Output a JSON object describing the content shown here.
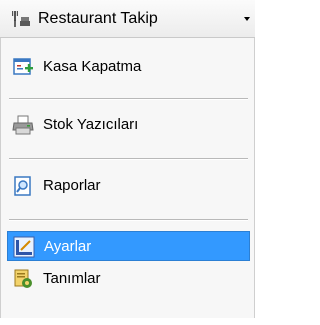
{
  "header": {
    "title": "Restaurant Takip",
    "icon": "restaurant-tools-icon"
  },
  "menu": {
    "items": [
      {
        "label": "Kasa Kapatma",
        "icon": "cash-register-icon"
      },
      {
        "label": "Stok Yazıcıları",
        "icon": "printer-icon"
      },
      {
        "label": "Raporlar",
        "icon": "report-search-icon"
      },
      {
        "label": "Ayarlar",
        "icon": "settings-ruler-icon",
        "selected": true
      },
      {
        "label": "Tanımlar",
        "icon": "definitions-icon"
      }
    ]
  },
  "colors": {
    "selection": "#3399ff",
    "selection_text": "#ffffff",
    "menu_background": "#f7f7f7"
  }
}
